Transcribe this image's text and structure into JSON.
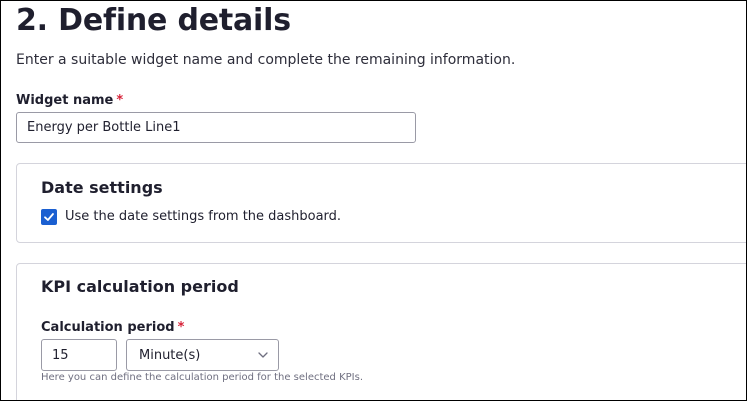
{
  "header": {
    "title": "2. Define details",
    "subtitle": "Enter a suitable widget name and complete the remaining information."
  },
  "widget_name": {
    "label": "Widget name",
    "required_mark": "*",
    "value": "Energy per Bottle Line1"
  },
  "date_settings": {
    "title": "Date settings",
    "checkbox_label": "Use the date settings from the dashboard.",
    "checked": true
  },
  "kpi_period": {
    "title": "KPI calculation period",
    "field_label": "Calculation period",
    "required_mark": "*",
    "amount_value": "15",
    "unit_selected": "Minute(s)",
    "helper_text": "Here you can define the calculation period for the selected KPIs."
  },
  "colors": {
    "accent": "#1a5fd1",
    "required": "#d72339",
    "border": "#d4d4dc"
  },
  "icons": {
    "checkbox": "checkmark-icon",
    "dropdown": "chevron-down-icon"
  }
}
